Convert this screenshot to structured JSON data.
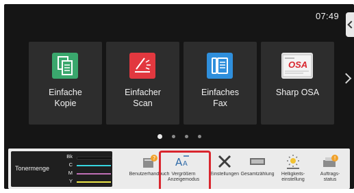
{
  "status": {
    "time": "07:49"
  },
  "tiles": [
    {
      "label": "Einfache\nKopie",
      "icon": "copy-icon",
      "color": "#3aa76d"
    },
    {
      "label": "Einfacher\nScan",
      "icon": "scan-icon",
      "color": "#e2383f"
    },
    {
      "label": "Einfaches\nFax",
      "icon": "fax-icon",
      "color": "#2f8fdc"
    },
    {
      "label": "Sharp OSA",
      "icon": "osa-logo",
      "osa_text": "OSA"
    }
  ],
  "pager": {
    "pages": 4,
    "active": 1
  },
  "toner": {
    "title": "Tonermenge",
    "rows": [
      {
        "key": "Bk",
        "color": "#111111"
      },
      {
        "key": "C",
        "color": "#36d6e0"
      },
      {
        "key": "M",
        "color": "#c070b6"
      },
      {
        "key": "Y",
        "color": "#efe94a"
      }
    ]
  },
  "functions": [
    {
      "label": "Benutzerhandbuch",
      "icon": "manual-icon"
    },
    {
      "label": "Vergrößern\nAnzeigemodus",
      "icon": "text-size-icon",
      "highlighted": true
    },
    {
      "label": "Einstellungen",
      "icon": "settings-icon"
    },
    {
      "label": "Gesamtzählung",
      "icon": "counter-icon"
    },
    {
      "label": "Helligkeits-\neinstellung",
      "icon": "brightness-icon"
    },
    {
      "label": "Auftrags-\nstatus",
      "icon": "job-status-icon"
    }
  ],
  "colors": {
    "highlight": "#d9262e",
    "background": "#151515",
    "tile": "#2d2d2d",
    "function_bar": "#ebebeb"
  }
}
